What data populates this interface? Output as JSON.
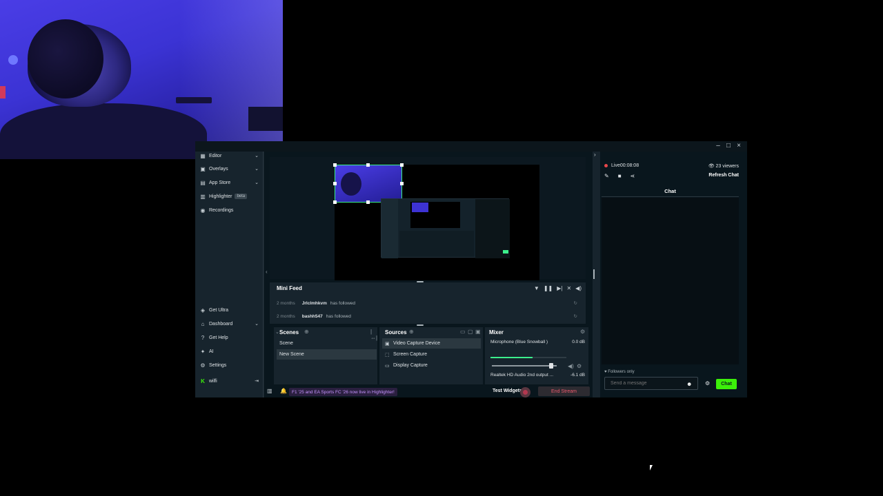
{
  "webcam": {
    "description_icon": "camera-feed"
  },
  "sidebar": {
    "items_top": [
      {
        "label": "Editor",
        "icon": "editor-icon"
      },
      {
        "label": "Overlays",
        "icon": "overlays-icon"
      },
      {
        "label": "App Store",
        "icon": "store-icon"
      },
      {
        "label": "Highlighter",
        "icon": "highlighter-icon",
        "badge": "beta"
      },
      {
        "label": "Recordings",
        "icon": "recordings-icon"
      }
    ],
    "items_bottom": [
      {
        "label": "Get Ultra",
        "icon": "ultra-icon"
      },
      {
        "label": "Dashboard",
        "icon": "dashboard-icon"
      },
      {
        "label": "Get Help",
        "icon": "help-icon"
      },
      {
        "label": "AI",
        "icon": "ai-icon"
      },
      {
        "label": "Settings",
        "icon": "settings-icon"
      },
      {
        "label": "wilfi",
        "icon": "user-icon"
      }
    ]
  },
  "minifeed": {
    "title": "Mini Feed",
    "rows": [
      {
        "time": "2 months",
        "user": "Jrlclmhkvm",
        "action": "has followed"
      },
      {
        "time": "2 months",
        "user": "bashh547",
        "action": "has followed"
      }
    ]
  },
  "scenes": {
    "title": "Scenes",
    "items": [
      "Scene",
      "New Scene"
    ],
    "active": "New Scene"
  },
  "sources": {
    "title": "Sources",
    "items": [
      "Video Capture Device",
      "Screen Capture",
      "Display Capture"
    ]
  },
  "mixer": {
    "title": "Mixer",
    "rows": [
      {
        "name": "Microphone (Blue Snowball )",
        "db": "0.0 dB"
      },
      {
        "name": "Realtek HD Audio 2nd output ...",
        "db": "-6.1 dB"
      }
    ],
    "mic_level": 0.55,
    "mic_volume": 0.92
  },
  "footer": {
    "promo": "F1 '25 and EA Sports FC '26 now live in Highlighter!",
    "test_widgets": "Test Widgets",
    "end_stream": "End Stream"
  },
  "chat": {
    "live_label": "Live",
    "live_time": "00:08:08",
    "viewers": "23 viewers",
    "refresh": "Refresh Chat",
    "header": "Chat",
    "followers_only": "Followers only",
    "placeholder": "Send a message",
    "send": "Chat"
  },
  "colors": {
    "accent": "#3cf00a",
    "live": "#e8474b",
    "end_stream": "#ee5a6e"
  }
}
